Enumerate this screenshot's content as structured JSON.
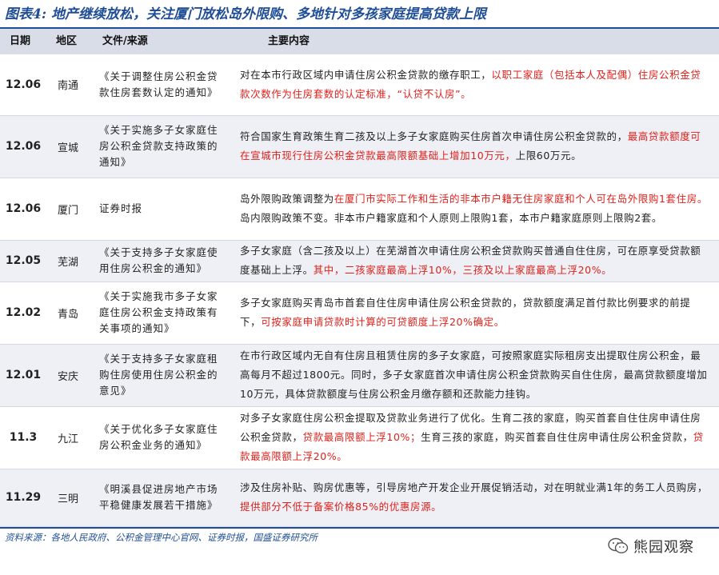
{
  "title": "图表4: 地产继续放松，关注厦门放松岛外限购、多地针对多孩家庭提高贷款上限",
  "header": {
    "date": "日期",
    "region": "地区",
    "doc": "文件/来源",
    "content": "主要内容"
  },
  "rows": [
    {
      "date": "12.06",
      "region": "南通",
      "doc": "《关于调整住房公积金贷款住房套数认定的通知》",
      "plain": "对在本市行政区域内申请住房公积金贷款的缴存职工，",
      "red": "以职工家庭（包括本人及配偶）住房公积金贷款次数作为住房套数的认定标准，“认贷不认房”。",
      "tail": ""
    },
    {
      "date": "12.06",
      "region": "宣城",
      "doc": "《关于实施多子女家庭住房公积金贷款支持政策的通知》",
      "plain": "符合国家生育政策生育二孩及以上多子女家庭购买住房首次申请住房公积金贷款的，",
      "red": "最高贷款额度可在宣城市现行住房公积金贷款最高限额基础上增加10万元，",
      "tail": "上限60万元。"
    },
    {
      "date": "12.06",
      "region": "厦门",
      "doc": "证券时报",
      "plain": "岛外限购政策调整为",
      "red": "在厦门市实际工作和生活的非本市户籍无住房家庭和个人可在岛外限购1套住房。",
      "tail": "岛内限购政策不变。非本市户籍家庭和个人原则上限购1套，本市户籍家庭原则上限购2套。"
    },
    {
      "date": "12.05",
      "region": "芜湖",
      "doc": "《关于支持多子女家庭使用住房公积金的通知》",
      "plain": "多子女家庭（含二孩及以上）在芜湖首次申请住房公积金贷款购买普通自住住房，可在原享受贷款额度基础上上浮。",
      "red": "其中，二孩家庭最高上浮10%，三孩及以上家庭最高上浮20%。",
      "tail": ""
    },
    {
      "date": "12.02",
      "region": "青岛",
      "doc": "《关于实施我市多子女家庭住房公积金支持政策有关事项的通知》",
      "plain": "多子女家庭购买青岛市首套自住住房申请住房公积金贷款的，贷款额度满足首付款比例要求的前提下，",
      "red": "可按家庭申请贷款时计算的可贷额度上浮20%确定。",
      "tail": ""
    },
    {
      "date": "12.01",
      "region": "安庆",
      "doc": "《关于支持多子女家庭租购住房使用住房公积金的意见》",
      "plain": "在市行政区域内无自有住房且租赁住房的多子女家庭，可按照家庭实际租房支出提取住房公积金，最高每月不超过1800元。同时，多子女家庭首次申请住房公积金贷款购买自住住房，最高贷款额度增加10万元，具体贷款额度与住房公积金月缴存额和还款能力挂钩。",
      "red": "",
      "tail": ""
    },
    {
      "date": "11.3",
      "region": "九江",
      "doc": "《关于优化多子女家庭住房公积金业务的通知》",
      "plain": "对多子女家庭住房公积金提取及贷款业务进行了优化。生育二孩的家庭，购买首套自住住房申请住房公积金贷款，",
      "red": "贷款最高限额上浮10%；",
      "tail": "生育三孩的家庭，购买首套自住住房申请住房公积金贷款，",
      "red2": "贷款最高限额上浮20%。"
    },
    {
      "date": "11.29",
      "region": "三明",
      "doc": "《明溪县促进房地产市场平稳健康发展若干措施》",
      "plain": "涉及住房补贴、购房优惠等，引导房地产开发企业开展促销活动，对在明就业满1年的务工人员购房，",
      "red": "提供部分不低于备案价格85%的优惠房源。",
      "tail": ""
    }
  ],
  "source": "资料来源：各地人民政府、公积金管理中心官网、证券时报，国盛证券研究所",
  "watermark": "熊园观察",
  "colors": {
    "accent": "#1f4e96",
    "highlight": "#e0201b",
    "row_shade": "#eef0f5"
  }
}
